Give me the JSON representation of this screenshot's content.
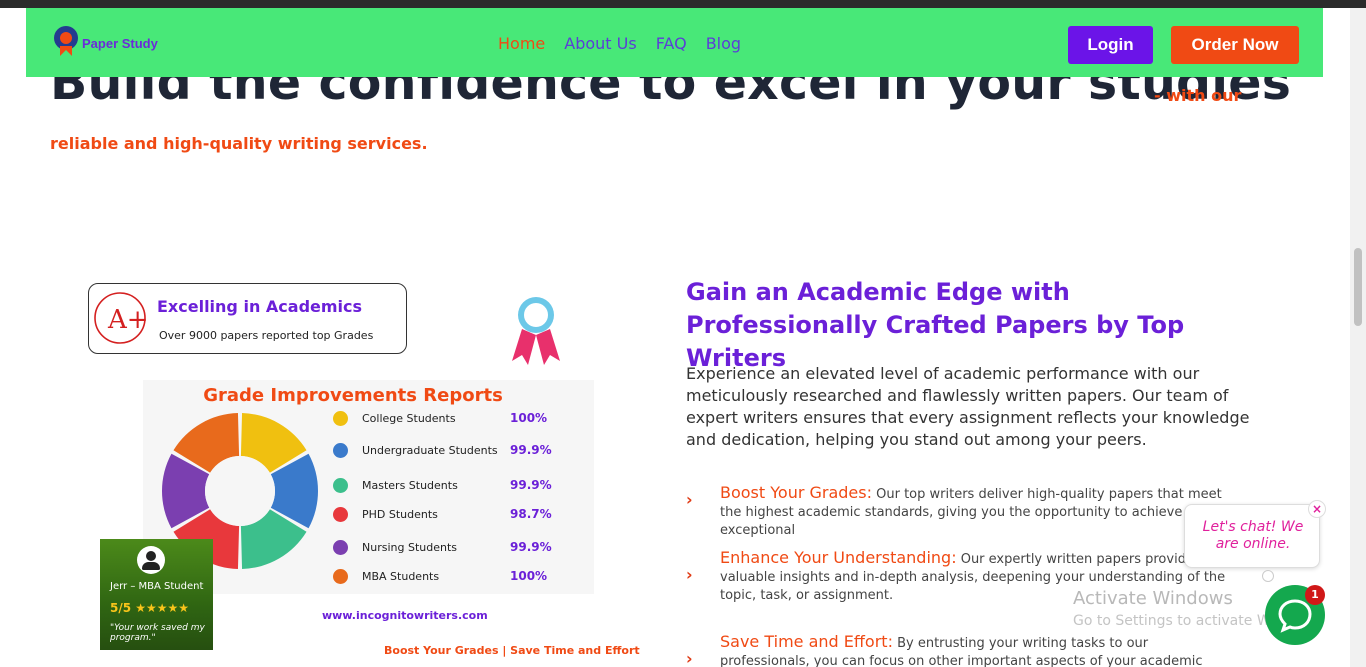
{
  "nav": {
    "brand": "Paper Study",
    "links": [
      "Home",
      "About Us",
      "FAQ",
      "Blog"
    ],
    "active_link": "Home",
    "login": "Login",
    "order": "Order Now",
    "colors": {
      "bar": "#48e878",
      "login": "#6b14e8",
      "order": "#f04a14"
    }
  },
  "hero": {
    "title": "Build the confidence to excel in your studies",
    "subtitle_1": "- with our",
    "subtitle_2": "reliable and high-quality writing services."
  },
  "excelling": {
    "grade": "A+",
    "title": "Excelling in Academics",
    "subtitle": "Over 9000 papers reported top Grades"
  },
  "report": {
    "title": "Grade Improvements Reports",
    "rows": [
      {
        "label": "College Students",
        "value": "100%",
        "color": "#f0c010"
      },
      {
        "label": "Undergraduate Students",
        "value": "99.9%",
        "color": "#3a7acb"
      },
      {
        "label": "Masters Students",
        "value": "99.9%",
        "color": "#3cbf8c"
      },
      {
        "label": "PHD Students",
        "value": "98.7%",
        "color": "#e8383c"
      },
      {
        "label": "Nursing Students",
        "value": "99.9%",
        "color": "#7b3fb0"
      },
      {
        "label": "MBA Students",
        "value": "100%",
        "color": "#e86a1c"
      }
    ],
    "url": "www.incognitowriters.com",
    "tagline": "Boost Your Grades | Save Time and Effort"
  },
  "review": {
    "name": "Jerr – MBA Student",
    "rating": "5/5 ★★★★★",
    "quote": "\"Your work saved my program.\""
  },
  "gain": {
    "title": "Gain an Academic Edge with Professionally Crafted Papers by Top Writers",
    "body": "Experience an elevated level of academic performance with our meticulously researched and flawlessly written papers. Our team of expert writers ensures that every assignment reflects your knowledge and dedication, helping you stand out among your peers.",
    "features": [
      {
        "head": "Boost Your Grades:",
        "text": " Our top writers deliver high-quality papers that meet the highest academic standards, giving you the opportunity to achieve exceptional"
      },
      {
        "head": "Enhance Your Understanding:",
        "text": " Our expertly written papers provide valuable insights and in-depth analysis, deepening your understanding of the topic, task, or assignment."
      },
      {
        "head": "Save Time and Effort:",
        "text": " By entrusting your writing tasks to our professionals, you can focus on other important aspects of your academic journey while still submitting"
      }
    ]
  },
  "windows": {
    "title": "Activate Windows",
    "sub": "Go to Settings to activate Windows."
  },
  "chat": {
    "message": "Let's chat! We are online.",
    "close": "×",
    "badge": "1"
  }
}
